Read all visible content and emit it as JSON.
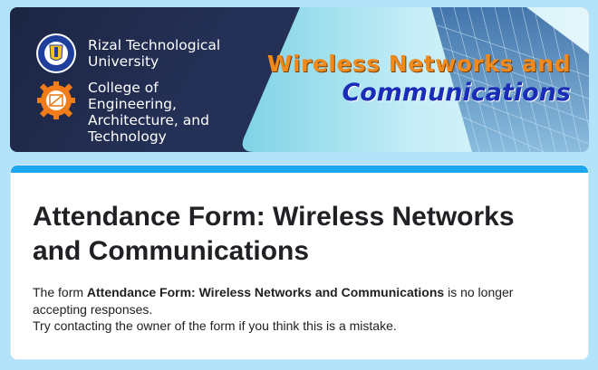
{
  "banner": {
    "university_line1": "Rizal Technological",
    "university_line2": "University",
    "college_line1": "College of",
    "college_line2": "Engineering,",
    "college_line3": "Architecture, and",
    "college_line4": "Technology",
    "course_line1": "Wireless Networks and",
    "course_line2": "Communications",
    "university_logo_icon": "rtu-seal-icon",
    "college_logo_icon": "gear-logo-icon"
  },
  "form": {
    "title": "Attendance Form: Wireless Networks and Communications",
    "notice_prefix": "The form ",
    "notice_form_name": "Attendance Form: Wireless Networks and Communications",
    "notice_suffix": " is no longer accepting responses.",
    "notice_line2": "Try contacting the owner of the form if you think this is a mistake."
  },
  "colors": {
    "page_background": "#b3e3fb",
    "accent": "#1aa7f0",
    "banner_dark": "#1c2542",
    "course_orange": "#f08a1c",
    "course_blue": "#1a2db8"
  }
}
